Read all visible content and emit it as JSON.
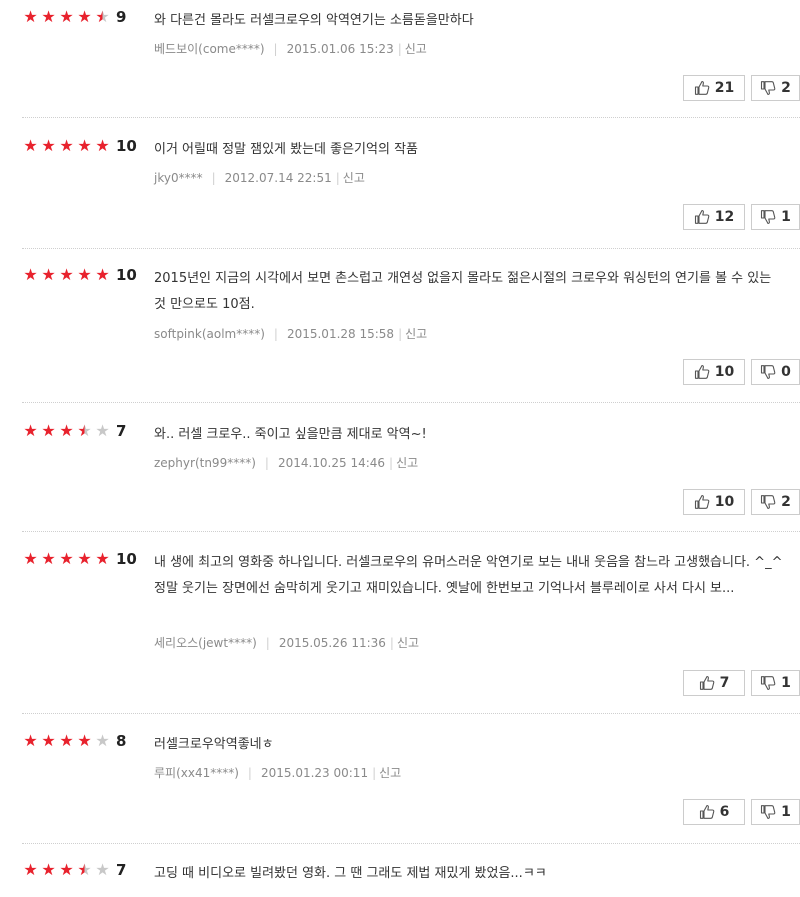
{
  "colors": {
    "star_on": "#e8222d",
    "star_off": "#c8c8c8",
    "meta": "#8a8a8a"
  },
  "icons": {
    "up": "thumbs-up-icon",
    "down": "thumbs-down-icon"
  },
  "report_label": "신고",
  "reviews": [
    {
      "rating": 9,
      "score": "9",
      "text": "와 다른건 몰라도 러셀크로우의 악역연기는 소름돋을만하다",
      "author": "베드보이(come****)",
      "date": "2015.01.06 15:23",
      "likes": "21",
      "dislikes": "2"
    },
    {
      "rating": 10,
      "score": "10",
      "text": "이거 어릴때 정말 잼있게 봤는데 좋은기억의 작품",
      "author": "jky0****",
      "date": "2012.07.14 22:51",
      "likes": "12",
      "dislikes": "1"
    },
    {
      "rating": 10,
      "score": "10",
      "text": "2015년인 지금의 시각에서 보면 촌스럽고 개연성 없을지 몰라도 젊은시절의 크로우와 워싱턴의 연기를 볼 수 있는 것 만으로도 10점.",
      "author": "softpink(aolm****)",
      "date": "2015.01.28 15:58",
      "likes": "10",
      "dislikes": "0"
    },
    {
      "rating": 7,
      "score": "7",
      "text": "와.. 러셀 크로우.. 죽이고 싶을만큼 제대로 악역~!",
      "author": "zephyr(tn99****)",
      "date": "2014.10.25 14:46",
      "likes": "10",
      "dislikes": "2"
    },
    {
      "rating": 10,
      "score": "10",
      "text": "내 생에 최고의 영화중 하나입니다. 러셀크로우의 유머스러운 악연기로 보는 내내 웃음을 참느라 고생했습니다. ^_^ 정말 웃기는 장면에선 숨막히게 웃기고 재미있습니다. 옛날에 한번보고 기억나서 블루레이로 사서 다시 보...",
      "author": "세리오스(jewt****)",
      "date": "2015.05.26 11:36",
      "likes": "7",
      "dislikes": "1"
    },
    {
      "rating": 8,
      "score": "8",
      "text": "러셀크로우악역좋네ㅎ",
      "author": "루피(xx41****)",
      "date": "2015.01.23 00:11",
      "likes": "6",
      "dislikes": "1"
    },
    {
      "rating": 7,
      "score": "7",
      "text": "고딩 때 비디오로 빌려봤던 영화. 그 땐 그래도 제법 재밌게 봤었음...ㅋㅋ",
      "author": "",
      "date": "",
      "likes": "",
      "dislikes": ""
    }
  ]
}
